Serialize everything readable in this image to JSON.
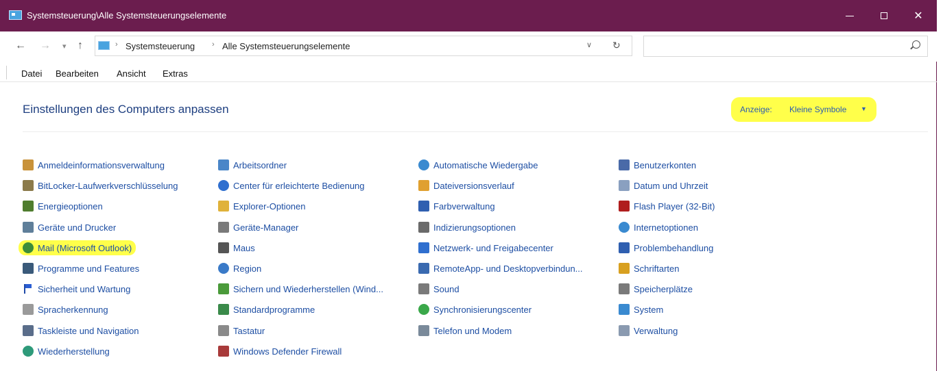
{
  "window": {
    "title": "Systemsteuerung\\Alle Systemsteuerungselemente",
    "titlebar_color": "#6b1d4e"
  },
  "nav": {
    "back": "←",
    "forward": "→",
    "recent": "▾",
    "up": "↑"
  },
  "address": {
    "crumb1": "Systemsteuerung",
    "crumb2": "Alle Systemsteuerungselemente",
    "sep": "›",
    "dropdown": "∨",
    "refresh": "↻"
  },
  "search": {
    "placeholder": "",
    "value": ""
  },
  "menu": [
    "Datei",
    "Bearbeiten",
    "Ansicht",
    "Extras"
  ],
  "page": {
    "title": "Einstellungen des Computers anpassen",
    "view_label": "Anzeige:",
    "view_value": "Kleine Symbole",
    "view_arrow": "▼",
    "highlight_color": "#ffff4a",
    "link_color": "#1d4ea3"
  },
  "items": {
    "col1": [
      {
        "label": "Anmeldeinformationsverwaltung",
        "icon": "credential-manager-icon",
        "color": "#c8923a"
      },
      {
        "label": "BitLocker-Laufwerkverschlüsselung",
        "icon": "bitlocker-icon",
        "color": "#8b7a4a"
      },
      {
        "label": "Energieoptionen",
        "icon": "power-options-icon",
        "color": "#4f7d2e"
      },
      {
        "label": "Geräte und Drucker",
        "icon": "devices-printers-icon",
        "color": "#5f7f9a"
      },
      {
        "label": "Mail (Microsoft Outlook)",
        "icon": "mail-icon",
        "color": "#3d8d3a",
        "highlighted": true
      },
      {
        "label": "Programme und Features",
        "icon": "programs-features-icon",
        "color": "#3a5a7a"
      },
      {
        "label": "Sicherheit und Wartung",
        "icon": "security-flag-icon",
        "color": "#1f4aa8"
      },
      {
        "label": "Spracherkennung",
        "icon": "microphone-icon",
        "color": "#9a9a9a"
      },
      {
        "label": "Taskleiste und Navigation",
        "icon": "taskbar-icon",
        "color": "#5a6d8a"
      },
      {
        "label": "Wiederherstellung",
        "icon": "recovery-icon",
        "color": "#2e9a7a"
      }
    ],
    "col2": [
      {
        "label": "Arbeitsordner",
        "icon": "work-folders-icon",
        "color": "#4a86c8"
      },
      {
        "label": "Center für erleichterte Bedienung",
        "icon": "ease-of-access-icon",
        "color": "#2f6fcf"
      },
      {
        "label": "Explorer-Optionen",
        "icon": "explorer-options-icon",
        "color": "#e0b23a"
      },
      {
        "label": "Geräte-Manager",
        "icon": "device-manager-icon",
        "color": "#7a7a7a"
      },
      {
        "label": "Maus",
        "icon": "mouse-icon",
        "color": "#555555"
      },
      {
        "label": "Region",
        "icon": "region-icon",
        "color": "#3a7ac8"
      },
      {
        "label": "Sichern und Wiederherstellen (Wind...",
        "icon": "backup-restore-icon",
        "color": "#4a9a3a"
      },
      {
        "label": "Standardprogramme",
        "icon": "default-programs-icon",
        "color": "#3a8a4a"
      },
      {
        "label": "Tastatur",
        "icon": "keyboard-icon",
        "color": "#8a8a8a"
      },
      {
        "label": "Windows Defender Firewall",
        "icon": "firewall-icon",
        "color": "#a83a3a"
      }
    ],
    "col3": [
      {
        "label": "Automatische Wiedergabe",
        "icon": "autoplay-icon",
        "color": "#3a8ad0"
      },
      {
        "label": "Dateiversionsverlauf",
        "icon": "file-history-icon",
        "color": "#e0a030"
      },
      {
        "label": "Farbverwaltung",
        "icon": "color-management-icon",
        "color": "#2f5fb0"
      },
      {
        "label": "Indizierungsoptionen",
        "icon": "indexing-icon",
        "color": "#6a6a6a"
      },
      {
        "label": "Netzwerk- und Freigabecenter",
        "icon": "network-center-icon",
        "color": "#2f6fcf"
      },
      {
        "label": "RemoteApp- und Desktopverbindun...",
        "icon": "remoteapp-icon",
        "color": "#3a6ab0"
      },
      {
        "label": "Sound",
        "icon": "sound-icon",
        "color": "#7a7a7a"
      },
      {
        "label": "Synchronisierungscenter",
        "icon": "sync-center-icon",
        "color": "#3aa84a"
      },
      {
        "label": "Telefon und Modem",
        "icon": "phone-modem-icon",
        "color": "#7a8a9a"
      }
    ],
    "col4": [
      {
        "label": "Benutzerkonten",
        "icon": "user-accounts-icon",
        "color": "#4a6aa8"
      },
      {
        "label": "Datum und Uhrzeit",
        "icon": "date-time-icon",
        "color": "#8aa0c0"
      },
      {
        "label": "Flash Player (32-Bit)",
        "icon": "flash-player-icon",
        "color": "#b01e1e"
      },
      {
        "label": "Internetoptionen",
        "icon": "internet-options-icon",
        "color": "#3a8ad0"
      },
      {
        "label": "Problembehandlung",
        "icon": "troubleshooting-icon",
        "color": "#2f5fb0"
      },
      {
        "label": "Schriftarten",
        "icon": "fonts-icon",
        "color": "#d8a020"
      },
      {
        "label": "Speicherplätze",
        "icon": "storage-spaces-icon",
        "color": "#7a7a7a"
      },
      {
        "label": "System",
        "icon": "system-icon",
        "color": "#3a8ad0"
      },
      {
        "label": "Verwaltung",
        "icon": "administration-icon",
        "color": "#8a9ab0"
      }
    ]
  }
}
